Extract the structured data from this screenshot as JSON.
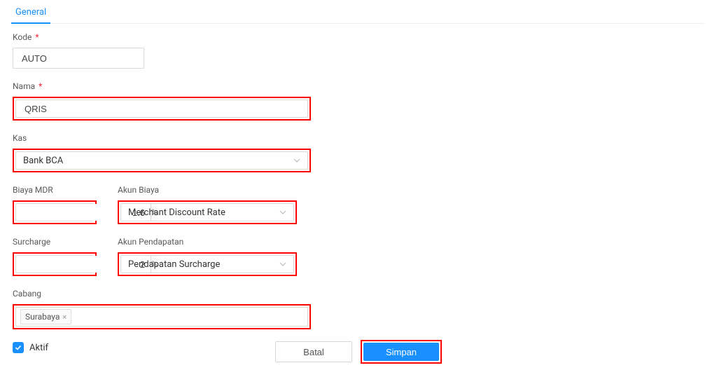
{
  "tabs": {
    "general": "General"
  },
  "labels": {
    "kode": "Kode",
    "nama": "Nama",
    "kas": "Kas",
    "biaya_mdr": "Biaya MDR",
    "akun_biaya": "Akun Biaya",
    "surcharge": "Surcharge",
    "akun_pendapatan": "Akun Pendapatan",
    "cabang": "Cabang",
    "aktif": "Aktif"
  },
  "required_marker": "*",
  "values": {
    "kode": "AUTO",
    "nama": "QRIS",
    "kas": "Bank BCA",
    "biaya_mdr": "1.6",
    "akun_biaya": "Merchant Discount Rate",
    "surcharge": "2",
    "akun_pendapatan": "Pendapatan Surcharge",
    "cabang_tag": "Surabaya",
    "aktif": true
  },
  "suffix": {
    "percent": "%"
  },
  "buttons": {
    "batal": "Batal",
    "simpan": "Simpan"
  }
}
